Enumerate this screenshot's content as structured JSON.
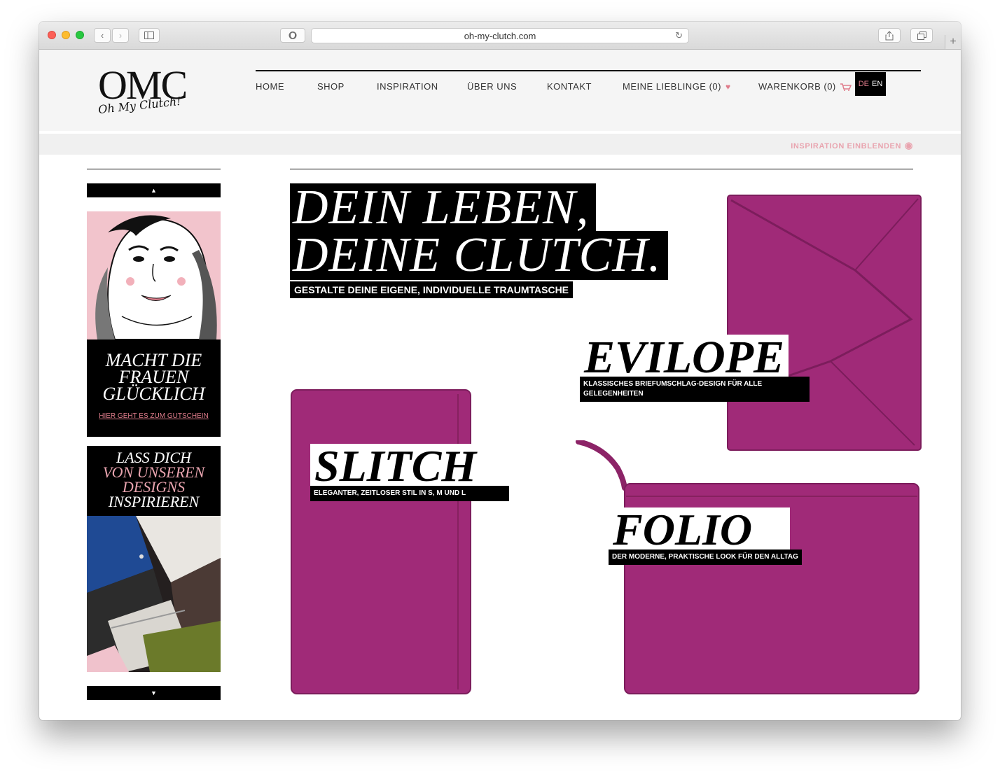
{
  "browser": {
    "url": "oh-my-clutch.com"
  },
  "logo": {
    "main": "OMC",
    "script": "Oh My Clutch!"
  },
  "nav": {
    "items": [
      {
        "label": "HOME"
      },
      {
        "label": "SHOP"
      },
      {
        "label": "INSPIRATION"
      },
      {
        "label": "ÜBER UNS"
      },
      {
        "label": "KONTAKT"
      },
      {
        "label": "MEINE LIEBLINGE (0)"
      },
      {
        "label": "WARENKORB (0)"
      }
    ],
    "lang": {
      "de": "DE",
      "en": "EN"
    }
  },
  "inspiration_toggle": "INSPIRATION EINBLENDEN",
  "sidebar": {
    "promo1": {
      "title_lines": [
        "MACHT DIE",
        "FRAUEN",
        "GLÜCKLICH"
      ],
      "link": "HIER GEHT ES ZUM GUTSCHEIN"
    },
    "promo2": {
      "line1": "LASS DICH",
      "line2": "VON UNSEREN",
      "line3": "DESIGNS",
      "line4": "INSPIRIEREN"
    },
    "up_arrow": "▲",
    "down_arrow": "▼"
  },
  "hero": {
    "line1": "DEIN LEBEN,",
    "line2": "DEINE CLUTCH.",
    "sub": "GESTALTE DEINE EIGENE, INDIVIDUELLE TRAUMTASCHE"
  },
  "products": [
    {
      "name": "EVILOPE",
      "desc": "KLASSISCHES BRIEFUMSCHLAG-DESIGN FÜR ALLE GELEGENHEITEN"
    },
    {
      "name": "SLITCH",
      "desc": "ELEGANTER, ZEITLOSER STIL IN S, M UND L"
    },
    {
      "name": "FOLIO",
      "desc": "DER MODERNE, PRAKTISCHE LOOK FÜR DEN ALLTAG"
    }
  ],
  "colors": {
    "accent_pink": "#e07d8c",
    "light_pink": "#e9a4af",
    "bag_magenta": "#a02a78",
    "black": "#000000"
  },
  "icons": [
    "back-icon",
    "forward-icon",
    "sidebar-icon",
    "shield-icon",
    "reload-icon",
    "share-icon",
    "tabs-icon",
    "plus-icon",
    "heart-icon",
    "cart-icon",
    "eye-icon"
  ]
}
